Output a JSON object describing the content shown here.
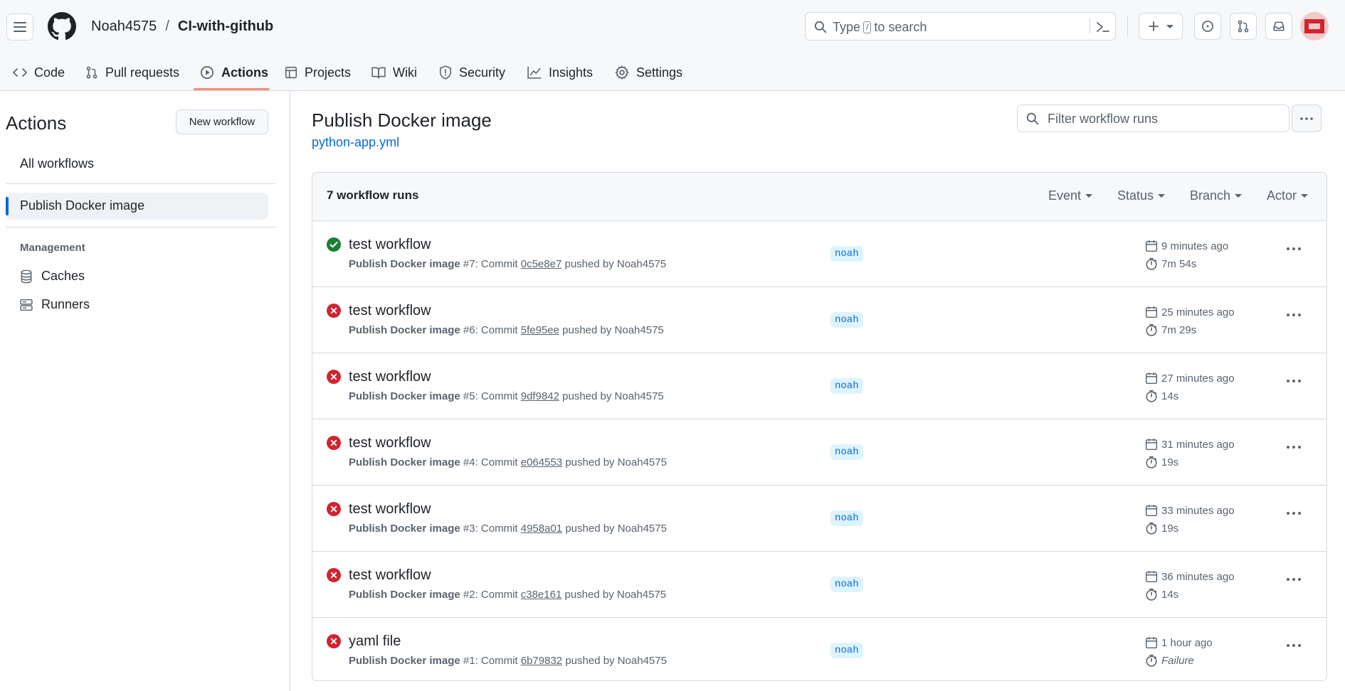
{
  "header": {
    "owner": "Noah4575",
    "separator": "/",
    "repo": "CI-with-github",
    "search_placeholder_pre": "Type",
    "search_key": "/",
    "search_placeholder_post": "to search"
  },
  "tabs": [
    {
      "label": "Code",
      "icon": "code-icon"
    },
    {
      "label": "Pull requests",
      "icon": "git-pull-request-icon"
    },
    {
      "label": "Actions",
      "icon": "play-icon",
      "active": true
    },
    {
      "label": "Projects",
      "icon": "table-icon"
    },
    {
      "label": "Wiki",
      "icon": "book-icon"
    },
    {
      "label": "Security",
      "icon": "shield-icon"
    },
    {
      "label": "Insights",
      "icon": "graph-icon"
    },
    {
      "label": "Settings",
      "icon": "gear-icon"
    }
  ],
  "sidebar": {
    "title": "Actions",
    "new_workflow": "New workflow",
    "all_workflows": "All workflows",
    "selected_workflow": "Publish Docker image",
    "management_heading": "Management",
    "caches": "Caches",
    "runners": "Runners"
  },
  "main": {
    "title": "Publish Docker image",
    "file_link": "python-app.yml",
    "filter_placeholder": "Filter workflow runs",
    "runs_count": "7 workflow runs",
    "filters": [
      "Event",
      "Status",
      "Branch",
      "Actor"
    ]
  },
  "runs": [
    {
      "status": "success",
      "title": "test workflow",
      "workflow": "Publish Docker image",
      "meta_mid": " #7: Commit ",
      "sha": "0c5e8e7",
      "pushed": " pushed by Noah4575",
      "branch": "noah",
      "when": "9 minutes ago",
      "duration": "7m 54s"
    },
    {
      "status": "failure",
      "title": "test workflow",
      "workflow": "Publish Docker image",
      "meta_mid": " #6: Commit ",
      "sha": "5fe95ee",
      "pushed": " pushed by Noah4575",
      "branch": "noah",
      "when": "25 minutes ago",
      "duration": "7m 29s"
    },
    {
      "status": "failure",
      "title": "test workflow",
      "workflow": "Publish Docker image",
      "meta_mid": " #5: Commit ",
      "sha": "9df9842",
      "pushed": " pushed by Noah4575",
      "branch": "noah",
      "when": "27 minutes ago",
      "duration": "14s"
    },
    {
      "status": "failure",
      "title": "test workflow",
      "workflow": "Publish Docker image",
      "meta_mid": " #4: Commit ",
      "sha": "e064553",
      "pushed": " pushed by Noah4575",
      "branch": "noah",
      "when": "31 minutes ago",
      "duration": "19s"
    },
    {
      "status": "failure",
      "title": "test workflow",
      "workflow": "Publish Docker image",
      "meta_mid": " #3: Commit ",
      "sha": "4958a01",
      "pushed": " pushed by Noah4575",
      "branch": "noah",
      "when": "33 minutes ago",
      "duration": "19s"
    },
    {
      "status": "failure",
      "title": "test workflow",
      "workflow": "Publish Docker image",
      "meta_mid": " #2: Commit ",
      "sha": "c38e161",
      "pushed": " pushed by Noah4575",
      "branch": "noah",
      "when": "36 minutes ago",
      "duration": "14s"
    },
    {
      "status": "failure",
      "title": "yaml file",
      "workflow": "Publish Docker image",
      "meta_mid": " #1: Commit ",
      "sha": "6b79832",
      "pushed": " pushed by Noah4575",
      "branch": "noah",
      "when": "1 hour ago",
      "duration": "Failure",
      "duration_italic": true
    }
  ],
  "colors": {
    "accent": "#0969da",
    "success": "#1a7f37",
    "failure": "#d1242f",
    "tab_underline": "#fd8c73"
  }
}
